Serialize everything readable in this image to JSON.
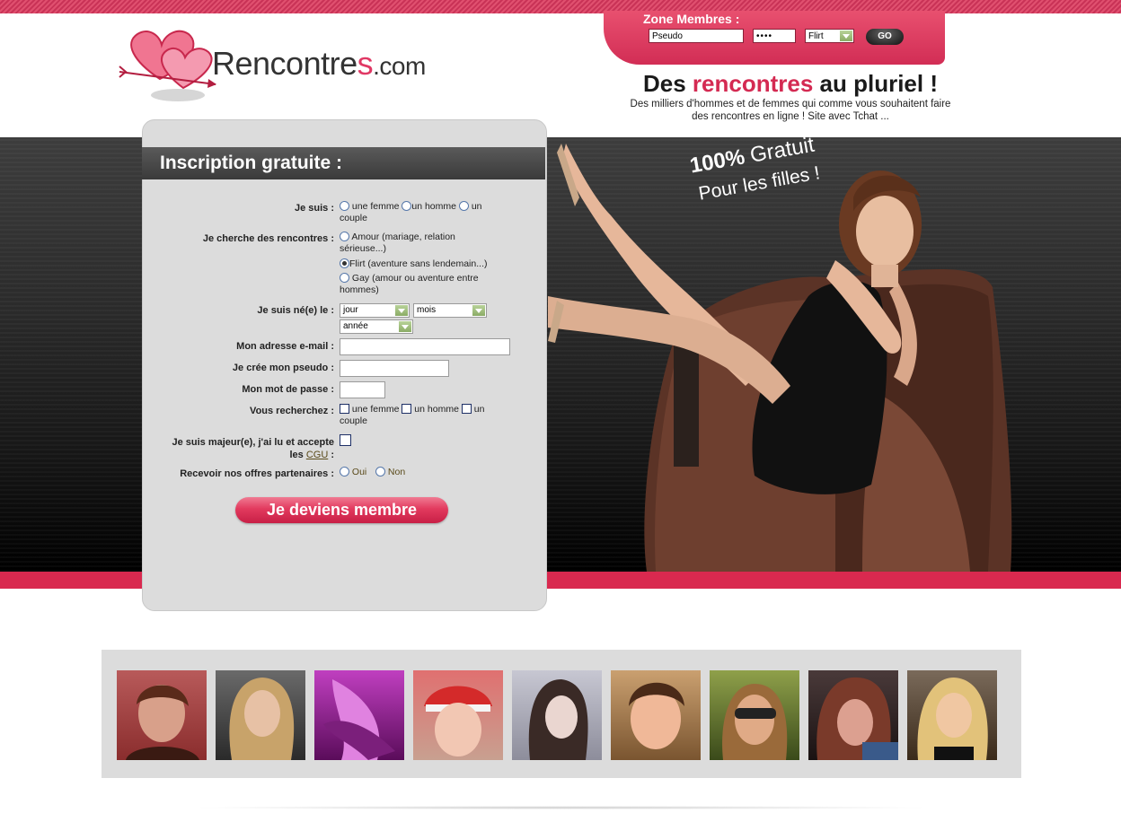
{
  "header": {
    "logo_text_main": "Rencontre",
    "logo_text_s": "s",
    "logo_text_com": ".com",
    "slogan_part1": "Des ",
    "slogan_highlight": "rencontres",
    "slogan_part2": " au pluriel !",
    "subslogan": "Des milliers d'hommes et de femmes qui comme vous souhaitent faire des rencontres en ligne ! Site avec Tchat ..."
  },
  "members_zone": {
    "title": "Zone Membres :",
    "pseudo_value": "Pseudo",
    "password_value": "••••",
    "mode_selected": "Flirt",
    "go_label": "GO"
  },
  "banner": {
    "promo_line1_bold": "100%",
    "promo_line1_rest": " Gratuit",
    "promo_line2": "Pour les filles !"
  },
  "form": {
    "title": "Inscription gratuite :",
    "je_suis_label": "Je suis :",
    "je_suis_options": [
      "une femme",
      "un homme",
      "un couple"
    ],
    "recherche_label": "Je cherche des rencontres :",
    "recherche_options": [
      "Amour (mariage, relation sérieuse...)",
      "Flirt (aventure sans lendemain...)",
      "Gay (amour ou aventure entre hommes)"
    ],
    "birth_label": "Je suis né(e) le :",
    "birth_day": "jour",
    "birth_month": "mois",
    "birth_year": "année",
    "email_label": "Mon adresse e-mail :",
    "pseudo_label": "Je crée mon pseudo :",
    "password_label": "Mon mot de passe :",
    "vous_recherchez_label": "Vous recherchez :",
    "vous_recherchez_options": [
      "une femme",
      "un homme",
      "un couple"
    ],
    "majeur_label_1": "Je suis majeur(e), j'ai lu et accepte",
    "majeur_label_les": "les ",
    "majeur_cgu": "CGU",
    "majeur_colon": " :",
    "offres_label": "Recevoir nos offres partenaires :",
    "offres_options": [
      "Oui",
      "Non"
    ],
    "submit_label": "Je deviens membre"
  },
  "colors": {
    "brand_pink": "#d9294f",
    "panel_grey": "#dcdcdc"
  },
  "gallery": {
    "thumbs": [
      "member-photo-1",
      "member-photo-2",
      "member-photo-3",
      "member-photo-4",
      "member-photo-5",
      "member-photo-6",
      "member-photo-7",
      "member-photo-8",
      "member-photo-9"
    ]
  }
}
